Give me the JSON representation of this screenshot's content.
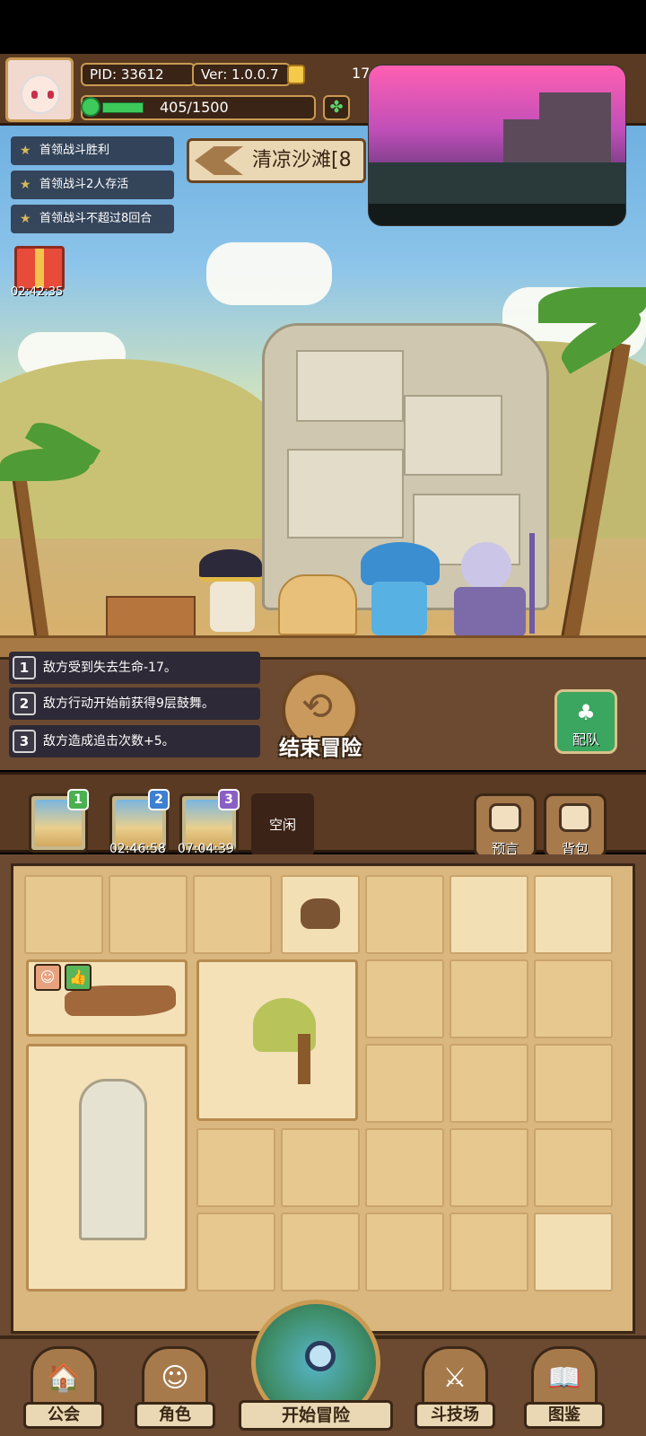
{
  "player": {
    "pid_label": "PID: 33612",
    "version_label": "Ver: 1.0.0.7",
    "coins": "17",
    "energy": "405/1500",
    "energy_fraction": 0.27
  },
  "quests": [
    {
      "label": "首领战斗胜利"
    },
    {
      "label": "首领战斗2人存活"
    },
    {
      "label": "首领战斗不超过8回合"
    }
  ],
  "stage": {
    "name": "清凉沙滩[8"
  },
  "gift": {
    "timer": "02:42:35"
  },
  "effects": [
    {
      "num": "1",
      "text": "敌方受到失去生命-17。"
    },
    {
      "num": "2",
      "text": "敌方行动开始前获得9层鼓舞。"
    },
    {
      "num": "3",
      "text": "敌方造成追击次数+5。"
    }
  ],
  "end_button": {
    "label": "结束冒险"
  },
  "team_button": {
    "label": "配队"
  },
  "floor_slots": [
    {
      "badge": "1",
      "badge_color": "#4caf50",
      "timer": ""
    },
    {
      "badge": "2",
      "badge_color": "#3d7fd1",
      "timer": "02:46:58"
    },
    {
      "badge": "3",
      "badge_color": "#8a5fc4",
      "timer": "07:04:39"
    }
  ],
  "idle_slot": {
    "label": "空闲"
  },
  "side_buttons": {
    "prophecy": "预言",
    "backpack": "背包"
  },
  "nav": {
    "guild": "公会",
    "character": "角色",
    "start": "开始冒险",
    "arena": "斗技场",
    "codex": "图鉴"
  },
  "colors": {
    "panel_brown": "#6b4a31",
    "dark_brown": "#3b2716",
    "sand": "#e7c88f",
    "energy_green": "#3ec95b"
  }
}
